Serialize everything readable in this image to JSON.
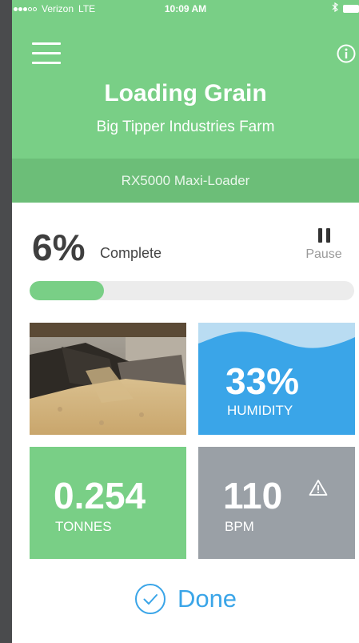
{
  "status_bar": {
    "carrier": "Verizon",
    "network": "LTE",
    "time": "10:09 AM"
  },
  "header": {
    "title": "Loading Grain",
    "subtitle": "Big Tipper Industries Farm",
    "machine": "RX5000 Maxi-Loader",
    "menu_icon": "hamburger-menu-icon",
    "info_icon": "info-icon"
  },
  "progress": {
    "percent_text": "6%",
    "label": "Complete",
    "bar_fill_fraction": 0.23,
    "pause_label": "Pause"
  },
  "tiles": {
    "humidity": {
      "value": "33%",
      "label": "HUMIDITY"
    },
    "tonnes": {
      "value": "0.254",
      "label": "TONNES"
    },
    "bpm": {
      "value": "110",
      "label": "BPM",
      "alert_icon": "warning-icon"
    }
  },
  "done": {
    "label": "Done",
    "icon": "check-circle-icon"
  },
  "colors": {
    "header_green": "#79cf86",
    "machine_bar_green": "#6cbe78",
    "humidity_blue": "#3aa5e8",
    "bpm_gray": "#9aa0a6",
    "done_blue": "#3aa5e8"
  }
}
